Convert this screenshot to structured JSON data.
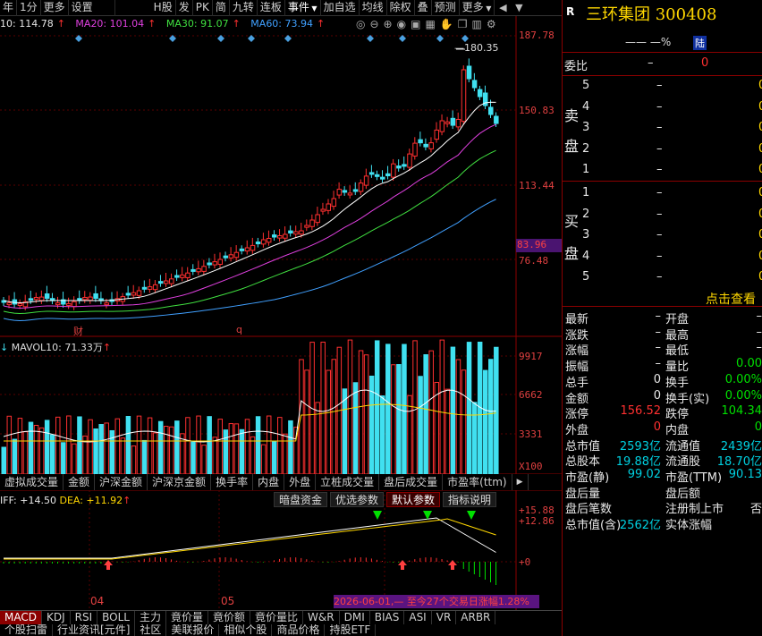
{
  "toolbar": {
    "items": [
      "年",
      "1分",
      "更多",
      "设置",
      "H股",
      "发",
      "PK",
      "简",
      "九转",
      "连板",
      "事件",
      "加自选",
      "均线",
      "除权",
      "叠",
      "预测",
      "更多"
    ],
    "icons": [
      "chevron-down-icon",
      "chevron-down-icon",
      "chevron-down-icon",
      "chevron-left-icon",
      "chevron-down-icon"
    ]
  },
  "ma_legend": {
    "ma10": "10: 114.78",
    "ma20": "MA20: 101.04",
    "ma30": "MA30: 91.07",
    "ma60": "MA60: 73.94",
    "arrows": [
      "↑",
      "↑",
      "↑",
      "↑"
    ]
  },
  "chart_tools": [
    "target-icon",
    "zoom-out-icon",
    "zoom-in-icon",
    "eye-icon",
    "lock-icon",
    "calendar-icon",
    "hand-icon",
    "copy-icon",
    "trash-icon",
    "gear-icon"
  ],
  "price_axis": {
    "labels": [
      "187.78",
      "150.83",
      "113.44",
      "76.48"
    ],
    "current": "83.96",
    "peak_label": "180.35"
  },
  "date_markers": {
    "cai": "财",
    "q": "q"
  },
  "volume": {
    "legend": "MAVOL10: 71.33万",
    "arrow": "↑",
    "axis": [
      "9917",
      "6662",
      "3331",
      "X100"
    ]
  },
  "indicator_tabs": [
    "虚拟成交量",
    "金额",
    "沪深金额",
    "沪深京金额",
    "换手率",
    "内盘",
    "外盘",
    "立桩成交量",
    "盘后成交量",
    "市盈率(ttm)"
  ],
  "macd": {
    "legend_dif": "IFF: +14.50",
    "legend_dea": "DEA: +11.92",
    "buttons": [
      "暗盘资金",
      "优选参数",
      "默认参数",
      "指标说明"
    ],
    "axis": [
      "+15.88",
      "+12.86",
      "+0"
    ],
    "months": [
      "04",
      "05"
    ],
    "info": "2026-06-01,— 至今27个交易日涨幅1.28%"
  },
  "bottom_tabs": [
    "MACD",
    "KDJ",
    "RSI",
    "BOLL",
    "主力",
    "竟价量",
    "竟价额",
    "竟价量比",
    "W&R",
    "DMI",
    "BIAS",
    "ASI",
    "VR",
    "ARBR"
  ],
  "bottom_tabs2": [
    "个股扫雷",
    "行业资讯[元件]",
    "社区",
    "美联报价",
    "相似个股",
    "商品价格",
    "持股ETF"
  ],
  "stock": {
    "r_label": "R",
    "name": "三环集团 300408",
    "sub": "—— —%",
    "lu": "陆",
    "weibi_label": "委比",
    "weibi_val": "–",
    "weibi_val2": "0"
  },
  "order_book": {
    "sell_label": [
      "卖",
      "盘"
    ],
    "buy_label": [
      "买",
      "盘"
    ],
    "sell": [
      [
        "5",
        "–",
        "0"
      ],
      [
        "4",
        "–",
        "0"
      ],
      [
        "3",
        "–",
        "0"
      ],
      [
        "2",
        "–",
        "0"
      ],
      [
        "1",
        "–",
        "0"
      ]
    ],
    "buy": [
      [
        "1",
        "–",
        "0"
      ],
      [
        "2",
        "–",
        "0"
      ],
      [
        "3",
        "–",
        "0"
      ],
      [
        "4",
        "–",
        "0"
      ],
      [
        "5",
        "–",
        "0"
      ]
    ],
    "click_view": "点击查看"
  },
  "quote": {
    "left": [
      [
        "最新",
        "–"
      ],
      [
        "涨跌",
        "–"
      ],
      [
        "涨幅",
        "–"
      ],
      [
        "振幅",
        "–"
      ],
      [
        "总手",
        "0"
      ],
      [
        "金额",
        "0"
      ],
      [
        "涨停",
        "156.52"
      ],
      [
        "外盘",
        "0"
      ],
      [
        "总市值",
        "2593亿"
      ],
      [
        "总股本",
        "19.88亿"
      ],
      [
        "市盈(静)",
        "99.02"
      ],
      [
        "盘后量",
        ""
      ],
      [
        "盘后笔数",
        ""
      ],
      [
        "总市值(含)",
        "2562亿"
      ]
    ],
    "right": [
      [
        "开盘",
        "–"
      ],
      [
        "最高",
        "–"
      ],
      [
        "最低",
        "–"
      ],
      [
        "量比",
        "0.00"
      ],
      [
        "换手",
        "0.00%"
      ],
      [
        "换手(实)",
        "0.00%"
      ],
      [
        "跌停",
        "104.34"
      ],
      [
        "内盘",
        "0"
      ],
      [
        "流通值",
        "2439亿"
      ],
      [
        "流通股",
        "18.70亿"
      ],
      [
        "市盈(TTM)",
        "90.13"
      ],
      [
        "盘后额",
        ""
      ],
      [
        "注册制上市",
        "否"
      ],
      [
        "实体涨幅",
        ""
      ]
    ]
  },
  "colors": {
    "up": "#ff3030",
    "down": "#40e0f0",
    "ma10": "#ffffff",
    "ma20": "#e040e0",
    "ma30": "#40e040",
    "ma60": "#40a0ff"
  }
}
